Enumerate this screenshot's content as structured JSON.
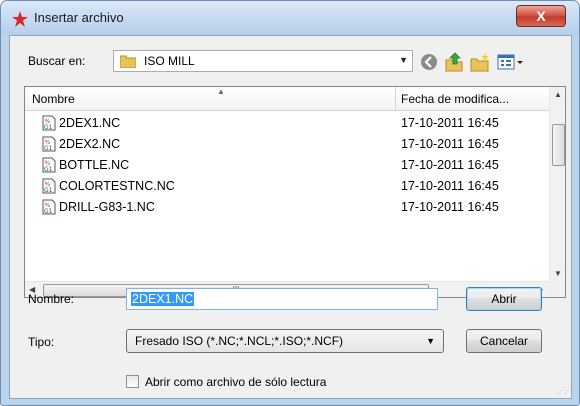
{
  "window": {
    "title": "Insertar archivo",
    "close_glyph": "X"
  },
  "toolbar": {
    "look_in_label": "Buscar en:",
    "look_in_value": "ISO MILL",
    "icons": [
      "back-icon",
      "up-folder-icon",
      "new-folder-icon",
      "view-menu-icon"
    ]
  },
  "filelist": {
    "columns": [
      "Nombre",
      "Fecha de modifica..."
    ],
    "rows": [
      {
        "name": "2DEX1.NC",
        "date": "17-10-2011 16:45"
      },
      {
        "name": "2DEX2.NC",
        "date": "17-10-2011 16:45"
      },
      {
        "name": "BOTTLE.NC",
        "date": "17-10-2011 16:45"
      },
      {
        "name": "COLORTESTNC.NC",
        "date": "17-10-2011 16:45"
      },
      {
        "name": "DRILL-G83-1.NC",
        "date": "17-10-2011 16:45"
      }
    ],
    "hscroll_grip": "III"
  },
  "form": {
    "name_label": "Nombre:",
    "name_value": "2DEX1.NC",
    "type_label": "Tipo:",
    "type_value": "Fresado ISO  (*.NC;*.NCL;*.ISO;*.NCF)",
    "readonly_label": "Abrir como archivo de sólo lectura",
    "readonly_checked": false
  },
  "buttons": {
    "open": "Abrir",
    "cancel": "Cancelar"
  },
  "colors": {
    "selection": "#3399ff",
    "frame": "#bcd3ec",
    "close": "#c23a2b"
  }
}
